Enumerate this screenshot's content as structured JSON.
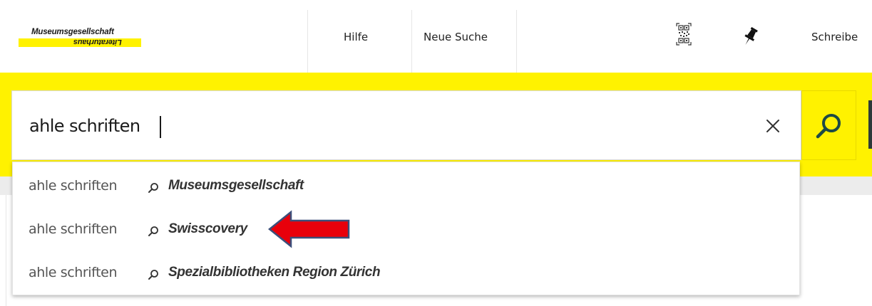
{
  "header": {
    "logo_line1": "Museumsgesellschaft",
    "logo_line2": "Literaturhaus",
    "nav": [
      {
        "label": "Hilfe"
      },
      {
        "label": "Neue Suche"
      }
    ],
    "qr_icon": "qr-code-icon",
    "pin_icon": "pushpin-icon",
    "partial_label": "Schreibe"
  },
  "search": {
    "value": "ahle schriften",
    "clear_icon": "close-icon",
    "submit_icon": "search-icon"
  },
  "suggestions": [
    {
      "query": "ahle schriften",
      "scope": "Museumsgesellschaft"
    },
    {
      "query": "ahle schriften",
      "scope": "Swisscovery"
    },
    {
      "query": "ahle schriften",
      "scope": "Spezialbibliotheken Region Zürich"
    }
  ],
  "annotation": {
    "arrow_target": "Swisscovery",
    "arrow_color": "#e8000b",
    "arrow_outline": "#3c4f7a"
  },
  "colors": {
    "accent": "#fff200",
    "text": "#222222"
  }
}
